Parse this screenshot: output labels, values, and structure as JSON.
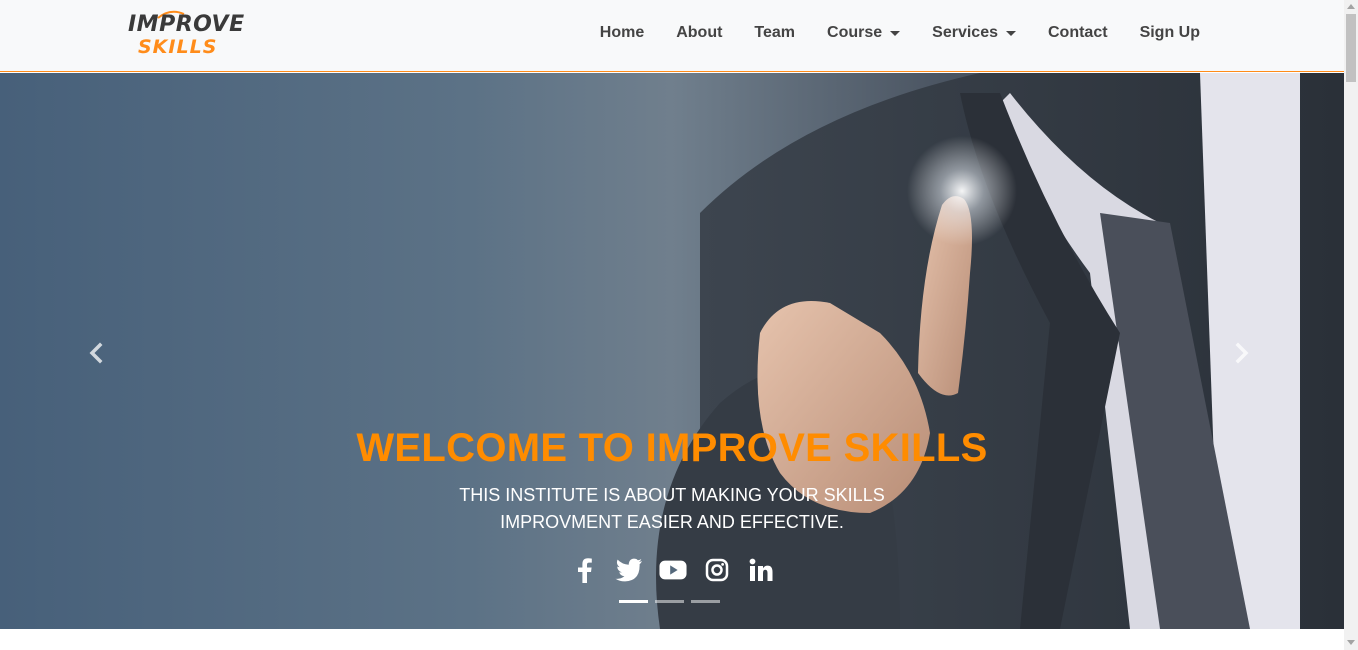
{
  "brand": {
    "logo_top": "IMPROVE",
    "logo_bottom": "SKILLS",
    "colors": {
      "accent": "#ff8c00",
      "nav_text": "#444444",
      "navbar_bg": "#f8f9fa"
    }
  },
  "nav": {
    "items": [
      {
        "label": "Home"
      },
      {
        "label": "About"
      },
      {
        "label": "Team"
      },
      {
        "label": "Course"
      },
      {
        "label": "Services"
      },
      {
        "label": "Contact"
      },
      {
        "label": "Sign Up"
      }
    ]
  },
  "hero": {
    "title": "WELCOME TO IMPROVE SKILLS",
    "subtitle_line1": "THIS INSTITUTE IS ABOUT MAKING YOUR SKILLS",
    "subtitle_line2": "IMPROVMENT EASIER AND EFFECTIVE.",
    "prev_icon": "chevron-left-icon",
    "next_icon": "chevron-right-icon",
    "socials": [
      "facebook-icon",
      "twitter-icon",
      "youtube-icon",
      "instagram-icon",
      "linkedin-icon"
    ],
    "slides_count": 3,
    "active_slide": 1
  }
}
